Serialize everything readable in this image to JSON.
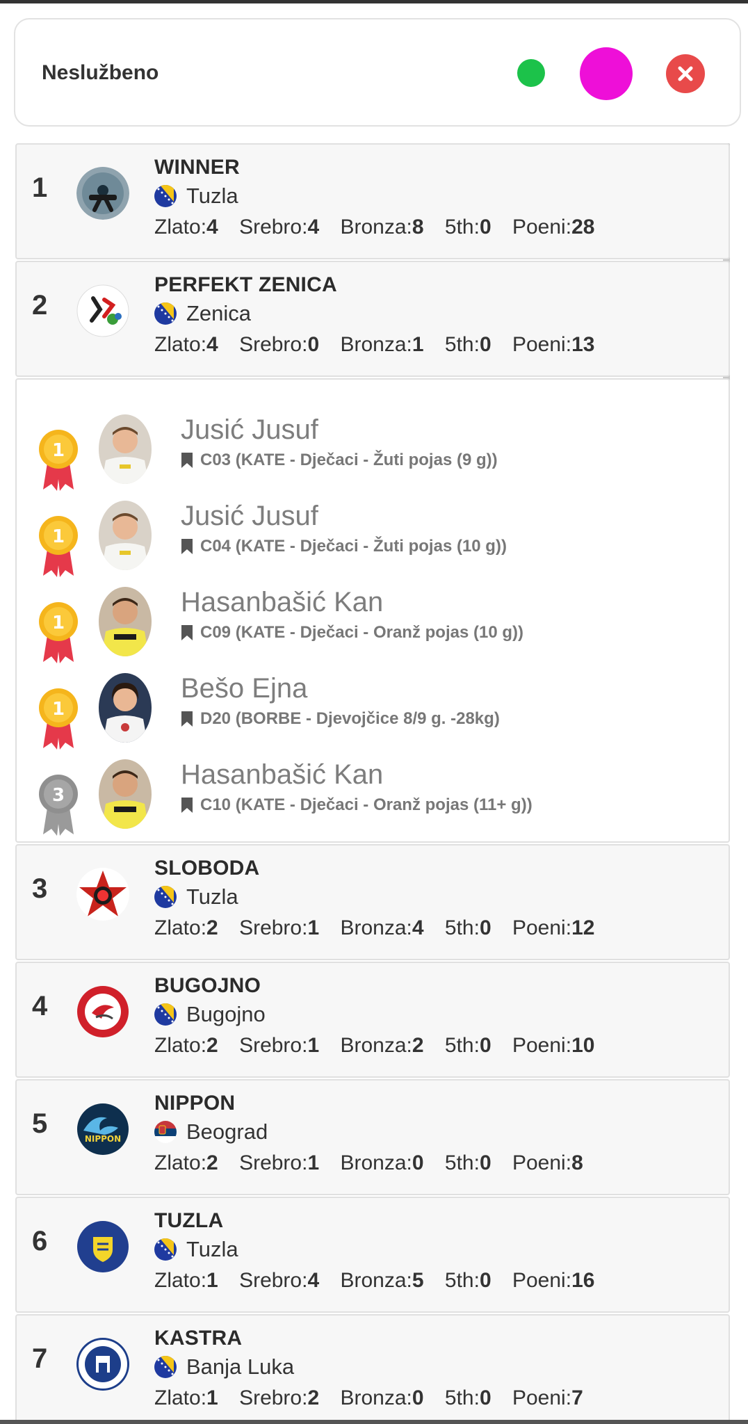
{
  "header": {
    "title": "Neslužbeno"
  },
  "colors": {
    "green": "#1cc24a",
    "magenta": "#ee0fd8",
    "close": "#e84a4a"
  },
  "labels": {
    "gold": "Zlato:",
    "silver": "Srebro:",
    "bronze": "Bronza:",
    "fifth": "5th:",
    "points": "Poeni:"
  },
  "clubs_top": [
    {
      "rank": "1",
      "name": "WINNER",
      "city": "Tuzla",
      "flag": "bih",
      "logo_icon": "karate-belt-logo-icon",
      "gold": "4",
      "silver": "4",
      "bronze": "8",
      "fifth": "0",
      "points": "28"
    },
    {
      "rank": "2",
      "name": "PERFEKT ZENICA",
      "city": "Zenica",
      "flag": "bih",
      "logo_icon": "perfekt-logo-icon",
      "gold": "4",
      "silver": "0",
      "bronze": "1",
      "fifth": "0",
      "points": "13"
    }
  ],
  "athletes": [
    {
      "name": "Jusić Jusuf",
      "category": "C03 (KATE - Dječaci - Žuti pojas (9 g))",
      "medal": "1"
    },
    {
      "name": "Jusić Jusuf",
      "category": "C04 (KATE - Dječaci - Žuti pojas (10 g))",
      "medal": "1"
    },
    {
      "name": "Hasanbašić Kan",
      "category": "C09 (KATE - Dječaci - Oranž pojas (10 g))",
      "medal": "1"
    },
    {
      "name": "Bešo Ejna",
      "category": "D20 (BORBE - Djevojčice 8/9 g. -28kg)",
      "medal": "1"
    },
    {
      "name": "Hasanbašić Kan",
      "category": "C10 (KATE - Dječaci - Oranž pojas (11+ g))",
      "medal": "3"
    }
  ],
  "clubs_bottom": [
    {
      "rank": "3",
      "name": "SLOBODA",
      "city": "Tuzla",
      "flag": "bih",
      "gold": "2",
      "silver": "1",
      "bronze": "4",
      "fifth": "0",
      "points": "12"
    },
    {
      "rank": "4",
      "name": "BUGOJNO",
      "city": "Bugojno",
      "flag": "bih",
      "gold": "2",
      "silver": "1",
      "bronze": "2",
      "fifth": "0",
      "points": "10"
    },
    {
      "rank": "5",
      "name": "NIPPON",
      "city": "Beograd",
      "flag": "srb",
      "gold": "2",
      "silver": "1",
      "bronze": "0",
      "fifth": "0",
      "points": "8"
    },
    {
      "rank": "6",
      "name": "TUZLA",
      "city": "Tuzla",
      "flag": "bih",
      "gold": "1",
      "silver": "4",
      "bronze": "5",
      "fifth": "0",
      "points": "16"
    },
    {
      "rank": "7",
      "name": "KASTRA",
      "city": "Banja Luka",
      "flag": "bih",
      "gold": "1",
      "silver": "2",
      "bronze": "0",
      "fifth": "0",
      "points": "7"
    }
  ],
  "logos": {
    "sloboda_text": "",
    "nippon_text": "NIPPON"
  }
}
